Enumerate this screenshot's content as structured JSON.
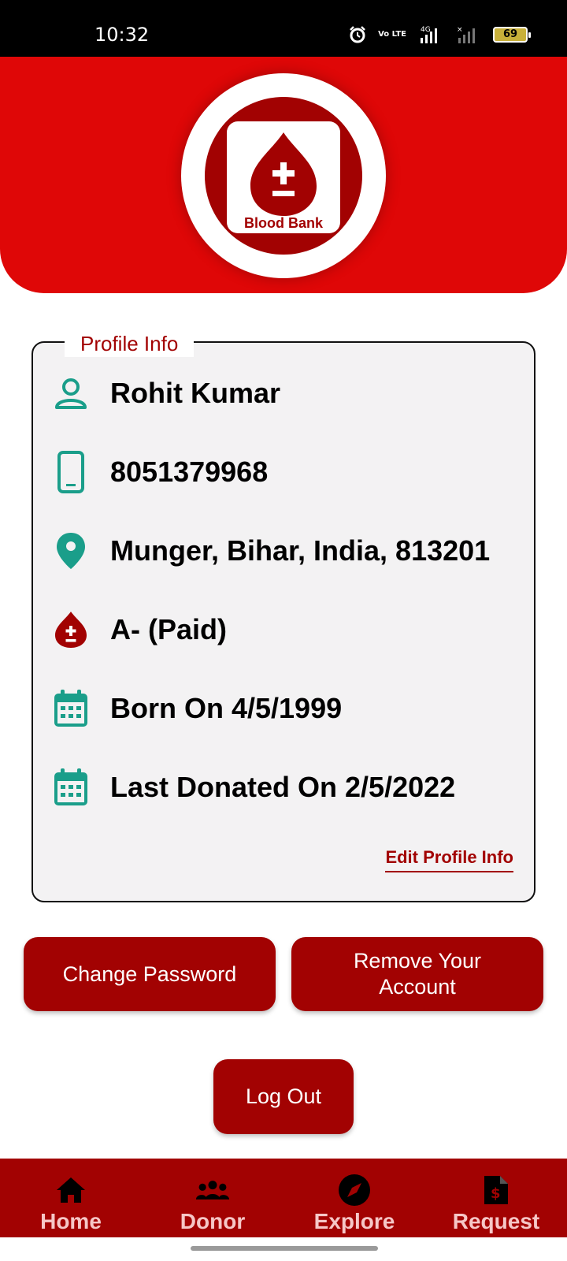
{
  "status_bar": {
    "time": "10:32",
    "network_label": "Vo LTE",
    "signal_label": "4G",
    "battery": "69"
  },
  "logo": {
    "text": "Blood Bank",
    "icon": "blood-drop-plus-minus-icon"
  },
  "profile": {
    "legend": "Profile Info",
    "rows": [
      {
        "icon": "person-icon",
        "text": "Rohit Kumar"
      },
      {
        "icon": "phone-icon",
        "text": "8051379968"
      },
      {
        "icon": "location-pin-icon",
        "text": "Munger, Bihar, India, 813201"
      },
      {
        "icon": "blood-drop-icon",
        "text": "A- (Paid)"
      },
      {
        "icon": "calendar-icon",
        "text": "Born On 4/5/1999"
      },
      {
        "icon": "calendar-icon",
        "text": "Last Donated On 2/5/2022"
      }
    ],
    "edit_link": "Edit Profile Info"
  },
  "actions": {
    "change_password": "Change Password",
    "remove_account": "Remove Your Account",
    "logout": "Log Out"
  },
  "nav": {
    "items": [
      {
        "label": "Home",
        "icon": "home-icon"
      },
      {
        "label": "Donor",
        "icon": "group-icon"
      },
      {
        "label": "Explore",
        "icon": "compass-icon"
      },
      {
        "label": "Request",
        "icon": "document-dollar-icon"
      }
    ]
  },
  "colors": {
    "header_red": "#df0707",
    "brand_dark_red": "#a20202",
    "icon_teal": "#1a9e8a",
    "nav_label": "#f6c7c7"
  }
}
